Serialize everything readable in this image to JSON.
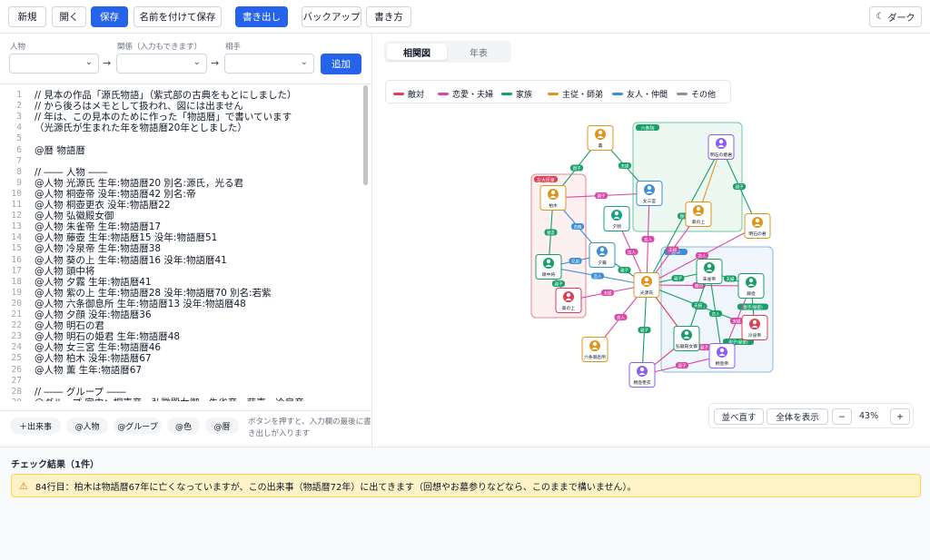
{
  "toolbar": {
    "new": "新規",
    "open": "開く",
    "save": "保存",
    "save_as": "名前を付けて保存",
    "export": "書き出し",
    "backup": "バックアップ",
    "syntax": "書き方",
    "dark": "ダーク"
  },
  "relation_form": {
    "person_label": "人物",
    "relation_label": "関係（入力もできます）",
    "partner_label": "相手",
    "arrow": "→",
    "add": "追加"
  },
  "editor": {
    "lines": [
      "// 見本の作品「源氏物語」（紫式部の古典をもとにしました）",
      "// から後ろはメモとして扱われ、図には出ません",
      "// 年は、この見本のために作った「物語暦」で書いています",
      "（光源氏が生まれた年を物語暦20年としました）",
      "",
      "@暦 物語暦",
      "",
      "// ―― 人物 ――",
      "@人物 光源氏 生年:物語暦20 別名:源氏，光る君",
      "@人物 桐壺帝 没年:物語暦42 別名:帝",
      "@人物 桐壺更衣 没年:物語暦22",
      "@人物 弘徽殿女御",
      "@人物 朱雀帝 生年:物語暦17",
      "@人物 藤壺 生年:物語暦15 没年:物語暦51",
      "@人物 冷泉帝 生年:物語暦38",
      "@人物 葵の上 生年:物語暦16 没年:物語暦41",
      "@人物 頭中将",
      "@人物 夕霧 生年:物語暦41",
      "@人物 紫の上 生年:物語暦28 没年:物語暦70 別名:若紫",
      "@人物 六条御息所 生年:物語暦13 没年:物語暦48",
      "@人物 夕顔 没年:物語暦36",
      "@人物 明石の君",
      "@人物 明石の姫君 生年:物語暦48",
      "@人物 女三宮 生年:物語暦46",
      "@人物 柏木 没年:物語暦67",
      "@人物 薫 生年:物語暦67",
      "",
      "// ―― グループ ――",
      "@グループ 宮中：桐壺帝，弘徽殿女御，朱雀帝，藤壺，冷泉帝"
    ]
  },
  "insert_chips": [
    "＋出来事",
    "@人物",
    "@グループ",
    "@色",
    "@暦"
  ],
  "insert_hint": "ボタンを押すと、入力欄の最後に書き出しが入ります",
  "tabs": [
    "相関図",
    "年表"
  ],
  "legend": [
    {
      "label": "敵対",
      "color": "#e03e52"
    },
    {
      "label": "恋愛・夫婦",
      "color": "#d946a8"
    },
    {
      "label": "家族",
      "color": "#16a065"
    },
    {
      "label": "主従・師弟",
      "color": "#e0941c"
    },
    {
      "label": "友人・仲間",
      "color": "#3b8fd6"
    },
    {
      "label": "その他",
      "color": "#8a93a3"
    }
  ],
  "graph": {
    "groups": [
      {
        "label": "六条院",
        "color": "#16a065"
      },
      {
        "label": "左大臣家",
        "color": "#e03e52"
      },
      {
        "label": "宮中",
        "color": "#3b8fd6"
      }
    ],
    "nodes": [
      {
        "id": "kaoru",
        "label": "薫",
        "color": "#e0941c"
      },
      {
        "id": "akashi_hime",
        "label": "明石の姫君",
        "color": "#8b5cf6"
      },
      {
        "id": "kashiwagi",
        "label": "柏木",
        "color": "#e0941c"
      },
      {
        "id": "onna3",
        "label": "女三宮",
        "color": "#3b8fd6"
      },
      {
        "id": "yugao",
        "label": "夕顔",
        "color": "#16a085"
      },
      {
        "id": "murasaki",
        "label": "紫の上",
        "color": "#e0941c"
      },
      {
        "id": "akashi",
        "label": "明石の君",
        "color": "#e0941c"
      },
      {
        "id": "yugiri",
        "label": "夕霧",
        "color": "#3b8fd6"
      },
      {
        "id": "tonochujo",
        "label": "頭中将",
        "color": "#16a065"
      },
      {
        "id": "genji",
        "label": "光源氏",
        "color": "#e0941c"
      },
      {
        "id": "suzaku",
        "label": "朱雀帝",
        "color": "#16a065"
      },
      {
        "id": "fujitsubo",
        "label": "藤壺",
        "color": "#16a065"
      },
      {
        "id": "aoi",
        "label": "葵の上",
        "color": "#e03e52"
      },
      {
        "id": "reizei",
        "label": "冷泉帝",
        "color": "#e03e52"
      },
      {
        "id": "kokiden",
        "label": "弘徽殿女御",
        "color": "#16a065"
      },
      {
        "id": "rokujo",
        "label": "六条御息所",
        "color": "#e0941c"
      },
      {
        "id": "kiritsubo",
        "label": "桐壺帝",
        "color": "#8b5cf6"
      },
      {
        "id": "kiritsubo_koi",
        "label": "桐壺更衣",
        "color": "#8b5cf6"
      }
    ],
    "edge_labels": [
      "親子",
      "夫婦",
      "親子",
      "親子",
      "恋敵",
      "親友",
      "恋人",
      "夫婦",
      "親子",
      "恋人",
      "親子",
      "兄弟",
      "恋人",
      "恋人",
      "親子",
      "夫婦",
      "恋人",
      "親子",
      "敵対",
      "敵対",
      "夫婦",
      "親子(秘密)",
      "夫婦",
      "親子(秘密)",
      "親子",
      "恋人",
      "夫婦",
      "親子",
      "親子"
    ]
  },
  "graph_controls": {
    "relayout": "並べ直す",
    "fit": "全体を表示",
    "zoom_out": "−",
    "zoom": "43%",
    "zoom_in": "+"
  },
  "check": {
    "title": "チェック結果（1件）",
    "warning": "84行目：柏木は物語暦67年に亡くなっていますが、この出来事（物語暦72年）に出てきます（回想やお墓参りなどなら、このままで構いません）。"
  }
}
